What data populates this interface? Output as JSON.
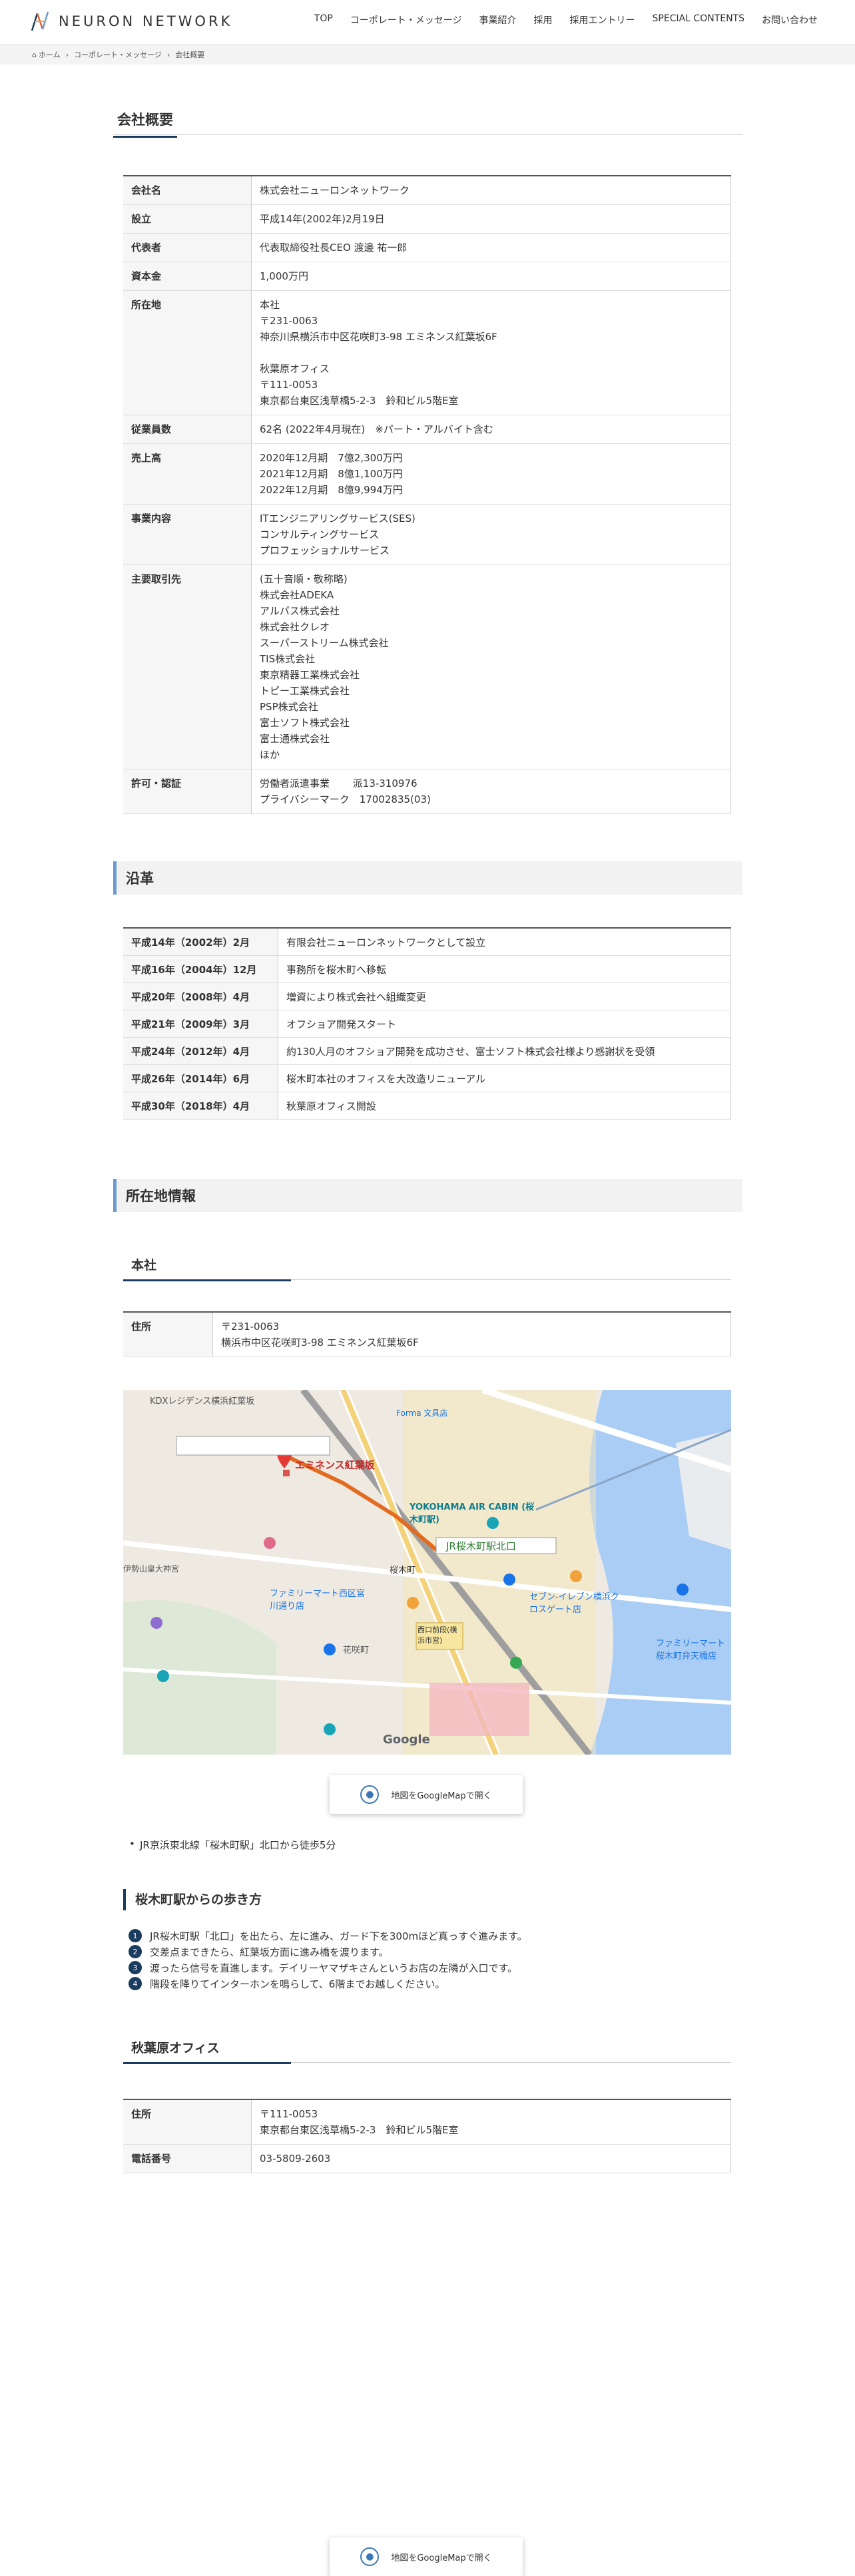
{
  "header": {
    "logo": "NEURON NETWORK",
    "nav": [
      "TOP",
      "コーポレート・メッセージ",
      "事業紹介",
      "採用",
      "採用エントリー",
      "SPECIAL CONTENTS",
      "お問い合わせ"
    ]
  },
  "breadcrumb": [
    "ホーム",
    "コーポレート・メッセージ",
    "会社概要"
  ],
  "overview": {
    "heading": "会社概要",
    "rows": [
      {
        "label": "会社名",
        "value": "株式会社ニューロンネットワーク"
      },
      {
        "label": "設立",
        "value": "平成14年(2002年)2月19日"
      },
      {
        "label": "代表者",
        "value": "代表取締役社長CEO 渡邊 祐一郎"
      },
      {
        "label": "資本金",
        "value": "1,000万円"
      },
      {
        "label": "所在地",
        "value": "本社\n〒231-0063\n神奈川県横浜市中区花咲町3-98 エミネンス紅葉坂6F\n\n秋葉原オフィス\n〒111-0053\n東京都台東区浅草橋5-2-3　鈴和ビル5階E室"
      },
      {
        "label": "従業員数",
        "value": "62名 (2022年4月現在)　※パート・アルバイト含む"
      },
      {
        "label": "売上高",
        "value": "2020年12月期　7億2,300万円\n2021年12月期　8億1,100万円\n2022年12月期　8億9,994万円"
      },
      {
        "label": "事業内容",
        "value": "ITエンジニアリングサービス(SES)\nコンサルティングサービス\nプロフェッショナルサービス"
      },
      {
        "label": "主要取引先",
        "value": "(五十音順・敬称略)\n株式会社ADEKA\nアルパス株式会社\n株式会社クレオ\nスーパーストリーム株式会社\nTIS株式会社\n東京精器工業株式会社\nトピー工業株式会社\nPSP株式会社\n富士ソフト株式会社\n富士通株式会社\nほか"
      },
      {
        "label": "許可・認証",
        "value": "労働者派遣事業　　 派13-310976\nプライバシーマーク　17002835(03)"
      }
    ]
  },
  "history": {
    "heading": "沿革",
    "rows": [
      {
        "date": "平成14年（2002年）2月",
        "event": "有限会社ニューロンネットワークとして設立"
      },
      {
        "date": "平成16年（2004年）12月",
        "event": "事務所を桜木町へ移転"
      },
      {
        "date": "平成20年（2008年）4月",
        "event": "増資により株式会社へ組織変更"
      },
      {
        "date": "平成21年（2009年）3月",
        "event": "オフショア開発スタート"
      },
      {
        "date": "平成24年（2012年）4月",
        "event": "約130人月のオフショア開発を成功させ、富士ソフト株式会社様より感謝状を受領"
      },
      {
        "date": "平成26年（2014年）6月",
        "event": "桜木町本社のオフィスを大改造リニューアル"
      },
      {
        "date": "平成30年（2018年）4月",
        "event": "秋葉原オフィス開設"
      }
    ]
  },
  "location": {
    "heading": "所在地情報",
    "hq": {
      "heading": "本社",
      "address_label": "住所",
      "address": "〒231-0063\n横浜市中区花咲町3-98 エミネンス紅葉坂6F",
      "map": {
        "labels": {
          "building": "エミネンス紅葉坂",
          "station": "JR桜木町駅北口",
          "yokohama_air": "YOKOHAMA AIR CABIN (桜木町駅)",
          "kdx": "KDXレジデンス横浜紅葉坂",
          "forma": "Forma 文具店",
          "omiya": "伊勢山皇大神宮",
          "family1": "ファミリーマート西区宮川通り店",
          "seven": "セブン-イレブン横浜クロスゲート店",
          "family2": "ファミリーマート桜木町弁天橋店",
          "sakuragicho": "桜木町",
          "hanasakicho": "花咲町",
          "kousaten": "西口前段(横浜市営)",
          "google": "Google"
        }
      },
      "map_button": "地図をGoogleMapで開く",
      "access": "JR京浜東北線「桜木町駅」北口から徒歩5分",
      "walk_heading": "桜木町駅からの歩き方",
      "steps": [
        "JR桜木町駅「北口」を出たら、左に進み、ガード下を300mほど真っすぐ進みます。",
        "交差点まできたら、紅葉坂方面に進み橋を渡ります。",
        "渡ったら信号を直進します。デイリーヤマザキさんというお店の左隣が入口です。",
        "階段を降りてインターホンを鳴らして、6階までお越しください。"
      ]
    },
    "akiba": {
      "heading": "秋葉原オフィス",
      "address_label": "住所",
      "address": "〒111-0053\n東京都台東区浅草橋5-2-3　鈴和ビル5階E室",
      "phone_label": "電話番号",
      "phone": "03-5809-2603",
      "map_button": "地図をGoogleMapで開く"
    }
  }
}
